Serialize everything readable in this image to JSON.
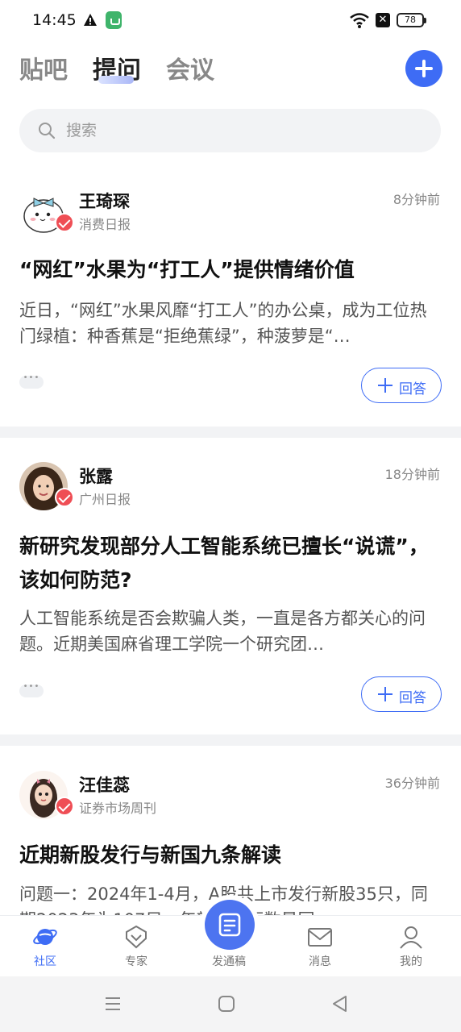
{
  "status_bar": {
    "time": "14:45",
    "battery": "78",
    "sim_icon": "✕",
    "icons": [
      "warning-icon",
      "app-notification-icon",
      "wifi-icon",
      "no-sim-icon",
      "battery-icon"
    ]
  },
  "top_tabs": {
    "items": [
      {
        "label": "贴吧",
        "active": false
      },
      {
        "label": "提问",
        "active": true
      },
      {
        "label": "会议",
        "active": false
      }
    ]
  },
  "search": {
    "placeholder": "搜索"
  },
  "colors": {
    "accent": "#3e6cf5",
    "verified": "#ef4e55",
    "separator": "#f2f3f5"
  },
  "posts": [
    {
      "author": "王琦琛",
      "source": "消费日报",
      "time": "8分钟前",
      "title": "“网红”水果为“打工人”提供情绪价值",
      "excerpt": "近日，“网红”水果风靡“打工人”的办公桌，成为工位热门绿植：种香蕉是“拒绝蕉绿”，种菠萝是“…",
      "answer_label": "回答"
    },
    {
      "author": "张露",
      "source": "广州日报",
      "time": "18分钟前",
      "title": "新研究发现部分人工智能系统已擅长“说谎”，该如何防范?",
      "excerpt": "人工智能系统是否会欺骗人类，一直是各方都关心的问题。近期美国麻省理工学院一个研究团…",
      "answer_label": "回答"
    },
    {
      "author": "汪佳蕊",
      "source": "证券市场周刊",
      "time": "36分钟前",
      "title": "近期新股发行与新国九条解读",
      "excerpt": "问题一：2024年1-4月，A股共上市发行新股35只，同期2023年为107只，年新股发行数量同"
    }
  ],
  "bottom_nav": {
    "items": [
      {
        "label": "社区",
        "icon": "planet-icon",
        "active": true
      },
      {
        "label": "专家",
        "icon": "expert-badge-icon",
        "active": false
      },
      {
        "label": "发通稿",
        "icon": "document-icon",
        "active": false
      },
      {
        "label": "消息",
        "icon": "mail-icon",
        "active": false
      },
      {
        "label": "我的",
        "icon": "user-icon",
        "active": false
      }
    ]
  },
  "system_nav": {
    "icons": [
      "menu-icon",
      "home-icon",
      "back-icon"
    ]
  }
}
